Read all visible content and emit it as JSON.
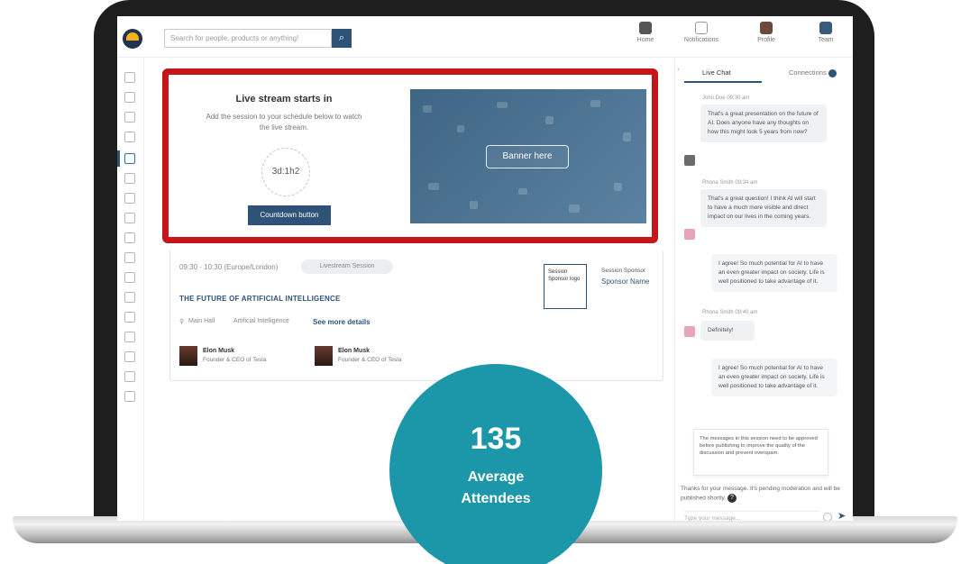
{
  "topbar": {
    "search_placeholder": "Search for people, products or anything!",
    "nav": [
      {
        "label": "Home"
      },
      {
        "label": "Notifications"
      },
      {
        "label": "Profile"
      },
      {
        "label": "Team"
      }
    ]
  },
  "livestream": {
    "title": "Live stream starts in",
    "subtitle": "Add the session to your schedule below to watch the live stream.",
    "countdown": "3d:1h2",
    "countdown_button": "Countdown button",
    "banner_label": "Banner here"
  },
  "session": {
    "time": "09:30 - 10:30 (Europe/London)",
    "pill": "Livestream Session",
    "title": "THE FUTURE OF ARTIFICIAL INTELLIGENCE",
    "location": "Main Hall",
    "tag": "Artificial Intelligence",
    "see_more": "See more details",
    "speakers": [
      {
        "name": "Elon Musk",
        "role": "Founder & CEO of Tesla"
      },
      {
        "name": "Elon Musk",
        "role": "Founder & CEO of Tesla"
      }
    ],
    "sponsor_box": "Session Sponsor logo",
    "sponsor_label": "Session Sponsor",
    "sponsor_name": "Sponsor Name"
  },
  "chat": {
    "tabs": {
      "live": "Live Chat",
      "connections": "Connections"
    },
    "messages": [
      {
        "sender": "John Doe  09:30 am",
        "text": "That's a great presentation on the future of AI. Does anyone have any thoughts on how this might look 5 years from now?"
      },
      {
        "sender": "Rhona Smith  09:34 am",
        "text": "That's a great question! I think AI will start to have a much more visible and direct impact on our lives in the coming years."
      },
      {
        "sender": "",
        "text": "I agree! So much potential for AI to have an even greater impact on society. Life is well positioned to take advantage of it."
      },
      {
        "sender": "Rhona Smith  09:40 am",
        "text": "Definitely!"
      },
      {
        "sender": "",
        "text": "I agree! So much potential for AI to have an even greater impact on society. Life is well positioned to take advantage of it."
      }
    ],
    "note": "The messages in this session need to be approved before publishing to improve the quality of the discussion and prevent overspam.",
    "approval": "Thanks for your message. It's pending moderation and will be published shortly.",
    "input_placeholder": "Type your message..."
  },
  "stat": {
    "number": "135",
    "label": "Average Attendees"
  },
  "colors": {
    "highlight": "#c7161b",
    "accent": "#2f5378",
    "stat": "#1b97a9"
  }
}
